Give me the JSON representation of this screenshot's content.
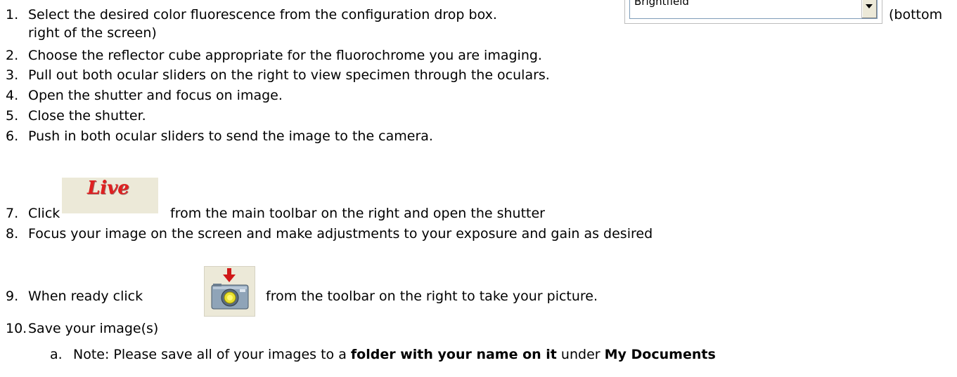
{
  "steps": [
    {
      "num": "1.",
      "pre": "Select the desired color fluorescence from the configuration drop box.",
      "post": "(bottom"
    },
    {
      "cont": "right of the screen)"
    },
    {
      "num": "2.",
      "text": "Choose the reflector cube appropriate for the fluorochrome you are imaging."
    },
    {
      "num": "3.",
      "text": "Pull out both ocular sliders on the right to view specimen through the oculars."
    },
    {
      "num": "4.",
      "text": "Open the shutter and focus on image."
    },
    {
      "num": "5.",
      "text": "Close the shutter."
    },
    {
      "num": "6.",
      "text": "Push in both ocular sliders to send the image to the camera."
    },
    {
      "num": "7.",
      "pre": "Click",
      "post": "from the main toolbar on the right and open the shutter"
    },
    {
      "num": "8.",
      "text": "Focus your image on the screen and make adjustments to your exposure and gain as desired"
    },
    {
      "num": "9.",
      "pre": "When ready click",
      "post": "from the toolbar on the right to take your picture."
    },
    {
      "num": "10.",
      "text": "Save your image(s)"
    }
  ],
  "note": {
    "letter": "a.",
    "part1": "Note: Please save all of your images to a ",
    "bold1": "folder with your name on it",
    "part2": " under ",
    "bold2": "My Documents"
  },
  "dropdown": {
    "value": "Brightfield"
  },
  "live_button": {
    "label": "Live"
  },
  "icons": {
    "live": "live-icon",
    "snap": "camera-snap-icon",
    "dropdown": "chevron-down-icon"
  }
}
